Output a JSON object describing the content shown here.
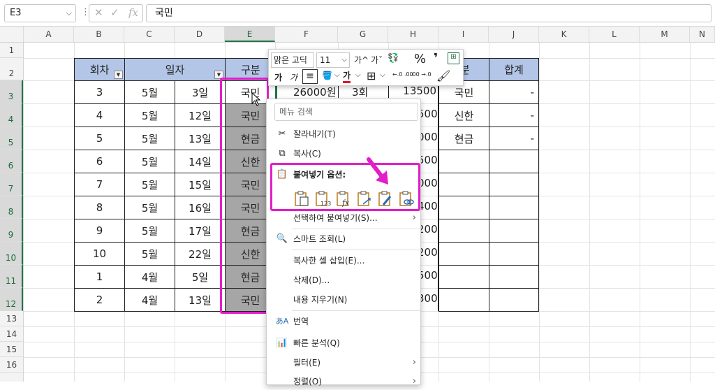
{
  "formula_bar": {
    "name_box": "E3",
    "name_box_dropdown": "chevron-down-icon",
    "input_value": "국민",
    "fx_label": "fx"
  },
  "columns": [
    "A",
    "B",
    "C",
    "D",
    "E",
    "F",
    "G",
    "H",
    "I",
    "J",
    "K",
    "L",
    "M",
    "N"
  ],
  "rows": [
    "1",
    "2",
    "3",
    "4",
    "5",
    "6",
    "7",
    "8",
    "9",
    "10",
    "11",
    "12",
    "13",
    "14",
    "15",
    "16"
  ],
  "table": {
    "headers": {
      "round": "회차",
      "date": "일자",
      "type": "구분",
      "type2": "분",
      "total": "합계"
    },
    "rows": [
      {
        "round": "3",
        "month": "5월",
        "day": "3일",
        "type": "국민",
        "i": "국민",
        "j": "-"
      },
      {
        "round": "4",
        "month": "5월",
        "day": "12일",
        "type": "국민",
        "i": "신한",
        "j": "-"
      },
      {
        "round": "5",
        "month": "5월",
        "day": "13일",
        "type": "현금",
        "i": "현금",
        "j": "-"
      },
      {
        "round": "6",
        "month": "5월",
        "day": "14일",
        "type": "신한",
        "i": "",
        "j": ""
      },
      {
        "round": "7",
        "month": "5월",
        "day": "15일",
        "type": "국민",
        "i": "",
        "j": ""
      },
      {
        "round": "8",
        "month": "5월",
        "day": "16일",
        "type": "국민",
        "i": "",
        "j": ""
      },
      {
        "round": "9",
        "month": "5월",
        "day": "17일",
        "type": "현금",
        "i": "",
        "j": ""
      },
      {
        "round": "10",
        "month": "5월",
        "day": "22일",
        "type": "신한",
        "i": "",
        "j": ""
      },
      {
        "round": "1",
        "month": "4월",
        "day": "5일",
        "type": "현금",
        "i": "",
        "j": ""
      },
      {
        "round": "2",
        "month": "4월",
        "day": "13일",
        "type": "국민",
        "i": "",
        "j": ""
      }
    ],
    "row3_extra": {
      "f": "26000원",
      "g": "3회"
    },
    "h_values": [
      "13500",
      "500",
      "000",
      "500",
      "000",
      "400",
      "200",
      "200",
      "500",
      "300"
    ]
  },
  "mini_toolbar": {
    "font_name": "맑은 고딕",
    "font_size": "11",
    "grow_font": "가^",
    "shrink_font": "가ˇ",
    "percent": "%",
    "comma": "❜",
    "bold": "가",
    "italic": "가",
    "font_color": "가",
    "font_color_hex": "#e81123",
    "dec_inc": "←.0 .00",
    "dec_dec": ".00 →.0"
  },
  "context_menu": {
    "search_placeholder": "메뉴 검색",
    "items": {
      "cut": "잘라내기(T)",
      "copy": "복사(C)",
      "paste_options": "붙여넣기 옵션:",
      "paste_special": "선택하여 붙여넣기(S)...",
      "smart_lookup": "스마트 조회(L)",
      "insert_copied": "복사한 셀 삽입(E)...",
      "delete": "삭제(D)...",
      "clear": "내용 지우기(N)",
      "translate": "번역",
      "quick_analysis": "빠른 분석(Q)",
      "filter": "필터(E)",
      "sort": "정렬(O)"
    }
  },
  "colors": {
    "header_fill": "#b4c6e7",
    "selected_fill": "#a6a6a6",
    "highlight": "#e31ec8",
    "excel_green": "#217346"
  }
}
